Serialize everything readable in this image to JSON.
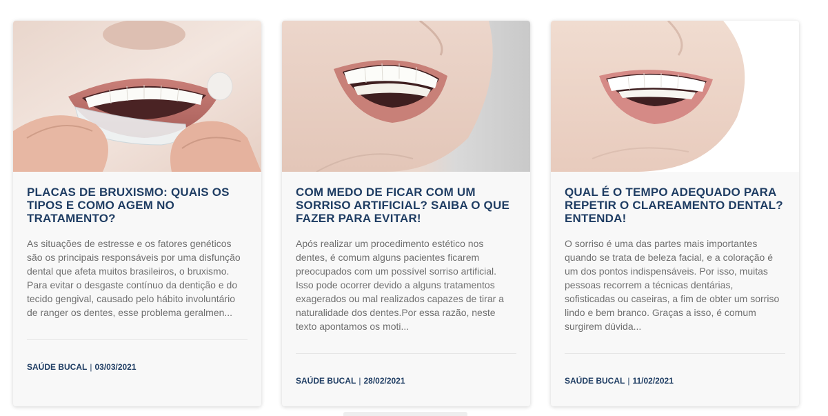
{
  "posts": [
    {
      "title": "PLACAS DE BRUXISMO: QUAIS OS TIPOS E COMO AGEM NO TRATAMENTO?",
      "excerpt": "As situações de estresse e os fatores genéticos são os principais responsáveis por uma disfunção dental que afeta muitos brasileiros, o bruxismo. Para evitar o desgaste contínuo da dentição e do tecido gengival, causado pelo hábito involuntário de ranger os dentes, esse problema geralmen...",
      "category": "SAÚDE BUCAL",
      "separator": "|",
      "date": "03/03/2021",
      "image": "woman-inserting-clear-aligner-photo"
    },
    {
      "title": "COM MEDO DE FICAR COM UM SORRISO ARTIFICIAL? SAIBA O QUE FAZER PARA EVITAR!",
      "excerpt": "Após realizar um procedimento estético nos dentes, é comum alguns pacientes ficarem preocupados com um possível sorriso artificial. Isso pode ocorrer devido a alguns tratamentos exagerados ou mal realizados capazes de tirar a naturalidade dos dentes.Por essa razão, neste texto apontamos os moti...",
      "category": "SAÚDE BUCAL",
      "separator": "|",
      "date": "28/02/2021",
      "image": "smiling-mouth-closeup-photo"
    },
    {
      "title": "QUAL É O TEMPO ADEQUADO PARA REPETIR O CLAREAMENTO DENTAL? ENTENDA!",
      "excerpt": "O sorriso é uma das partes mais importantes quando se trata de beleza facial, e a coloração é um dos pontos indispensáveis. Por isso, muitas pessoas recorrem a técnicas dentárias, sofisticadas ou caseiras, a fim de obter um sorriso lindo e bem branco. Graças a isso, é comum surgirem dúvida...",
      "category": "SAÚDE BUCAL",
      "separator": "|",
      "date": "11/02/2021",
      "image": "white-smile-closeup-photo"
    }
  ],
  "colors": {
    "title": "#1f3d63",
    "excerpt": "#6f6f6f",
    "card_bg": "#f8f8f8"
  }
}
